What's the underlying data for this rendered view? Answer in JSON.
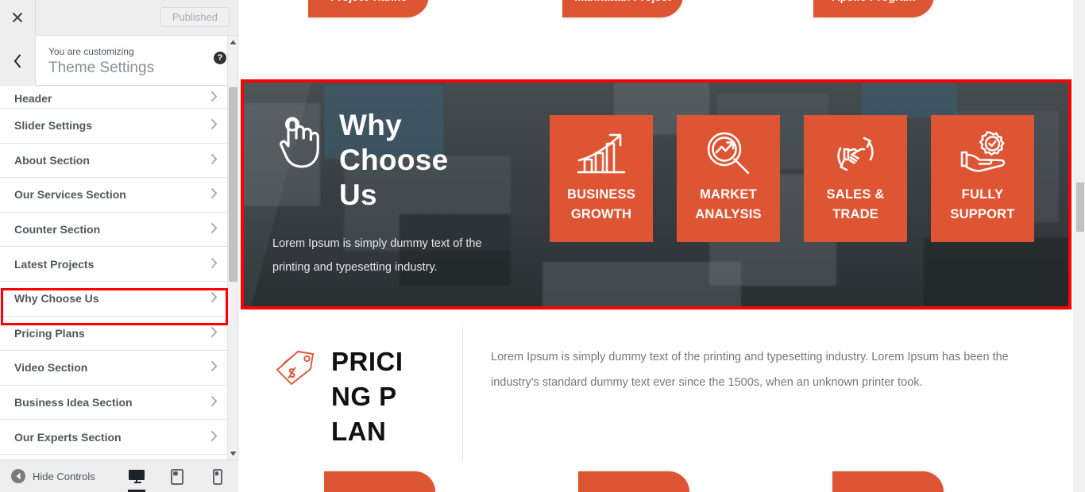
{
  "customizer": {
    "close_label": "×",
    "publish_label": "Published",
    "customizing_label": "You are customizing",
    "panel_title": "Theme Settings",
    "help_label": "?",
    "back_label": "‹",
    "items": [
      {
        "label": "Header"
      },
      {
        "label": "Slider Settings"
      },
      {
        "label": "About Section"
      },
      {
        "label": "Our Services Section"
      },
      {
        "label": "Counter Section"
      },
      {
        "label": "Latest Projects"
      },
      {
        "label": "Why Choose Us"
      },
      {
        "label": "Pricing Plans"
      },
      {
        "label": "Video Section"
      },
      {
        "label": "Business Idea Section"
      },
      {
        "label": "Our Experts Section"
      }
    ],
    "selected_item": "Why Choose Us",
    "footer": {
      "hide_controls_label": "Hide Controls",
      "devices": [
        {
          "name": "desktop",
          "active": true
        },
        {
          "name": "tablet",
          "active": false
        },
        {
          "name": "mobile",
          "active": false
        }
      ]
    }
  },
  "preview": {
    "project_tags": [
      {
        "label": "Project Tianhe"
      },
      {
        "label": "Manhattan Project"
      },
      {
        "label": "Apollo Program"
      }
    ],
    "why_choose_us": {
      "title": "Why Choose Us",
      "description": "Lorem Ipsum is simply dummy text of the printing and typesetting industry.",
      "cards": [
        {
          "caption": "BUSINESS GROWTH",
          "icon": "bar-chart-growth-icon"
        },
        {
          "caption": "MARKET ANALYSIS",
          "icon": "magnifier-analysis-icon"
        },
        {
          "caption": "SALES & TRADE",
          "icon": "handshake-exchange-icon"
        },
        {
          "caption": "FULLY SUPPORT",
          "icon": "hand-gear-support-icon"
        }
      ]
    },
    "pricing": {
      "title": "PRICING PLAN",
      "body": "Lorem Ipsum is simply dummy text of the printing and typesetting industry. Lorem Ipsum has been the industry's standard dummy text ever since the 1500s, when an unknown printer took."
    }
  },
  "colors": {
    "accent_orange": "#dd5533",
    "band_dark": "#3a3f41",
    "annotation_red": "#ff0000"
  }
}
